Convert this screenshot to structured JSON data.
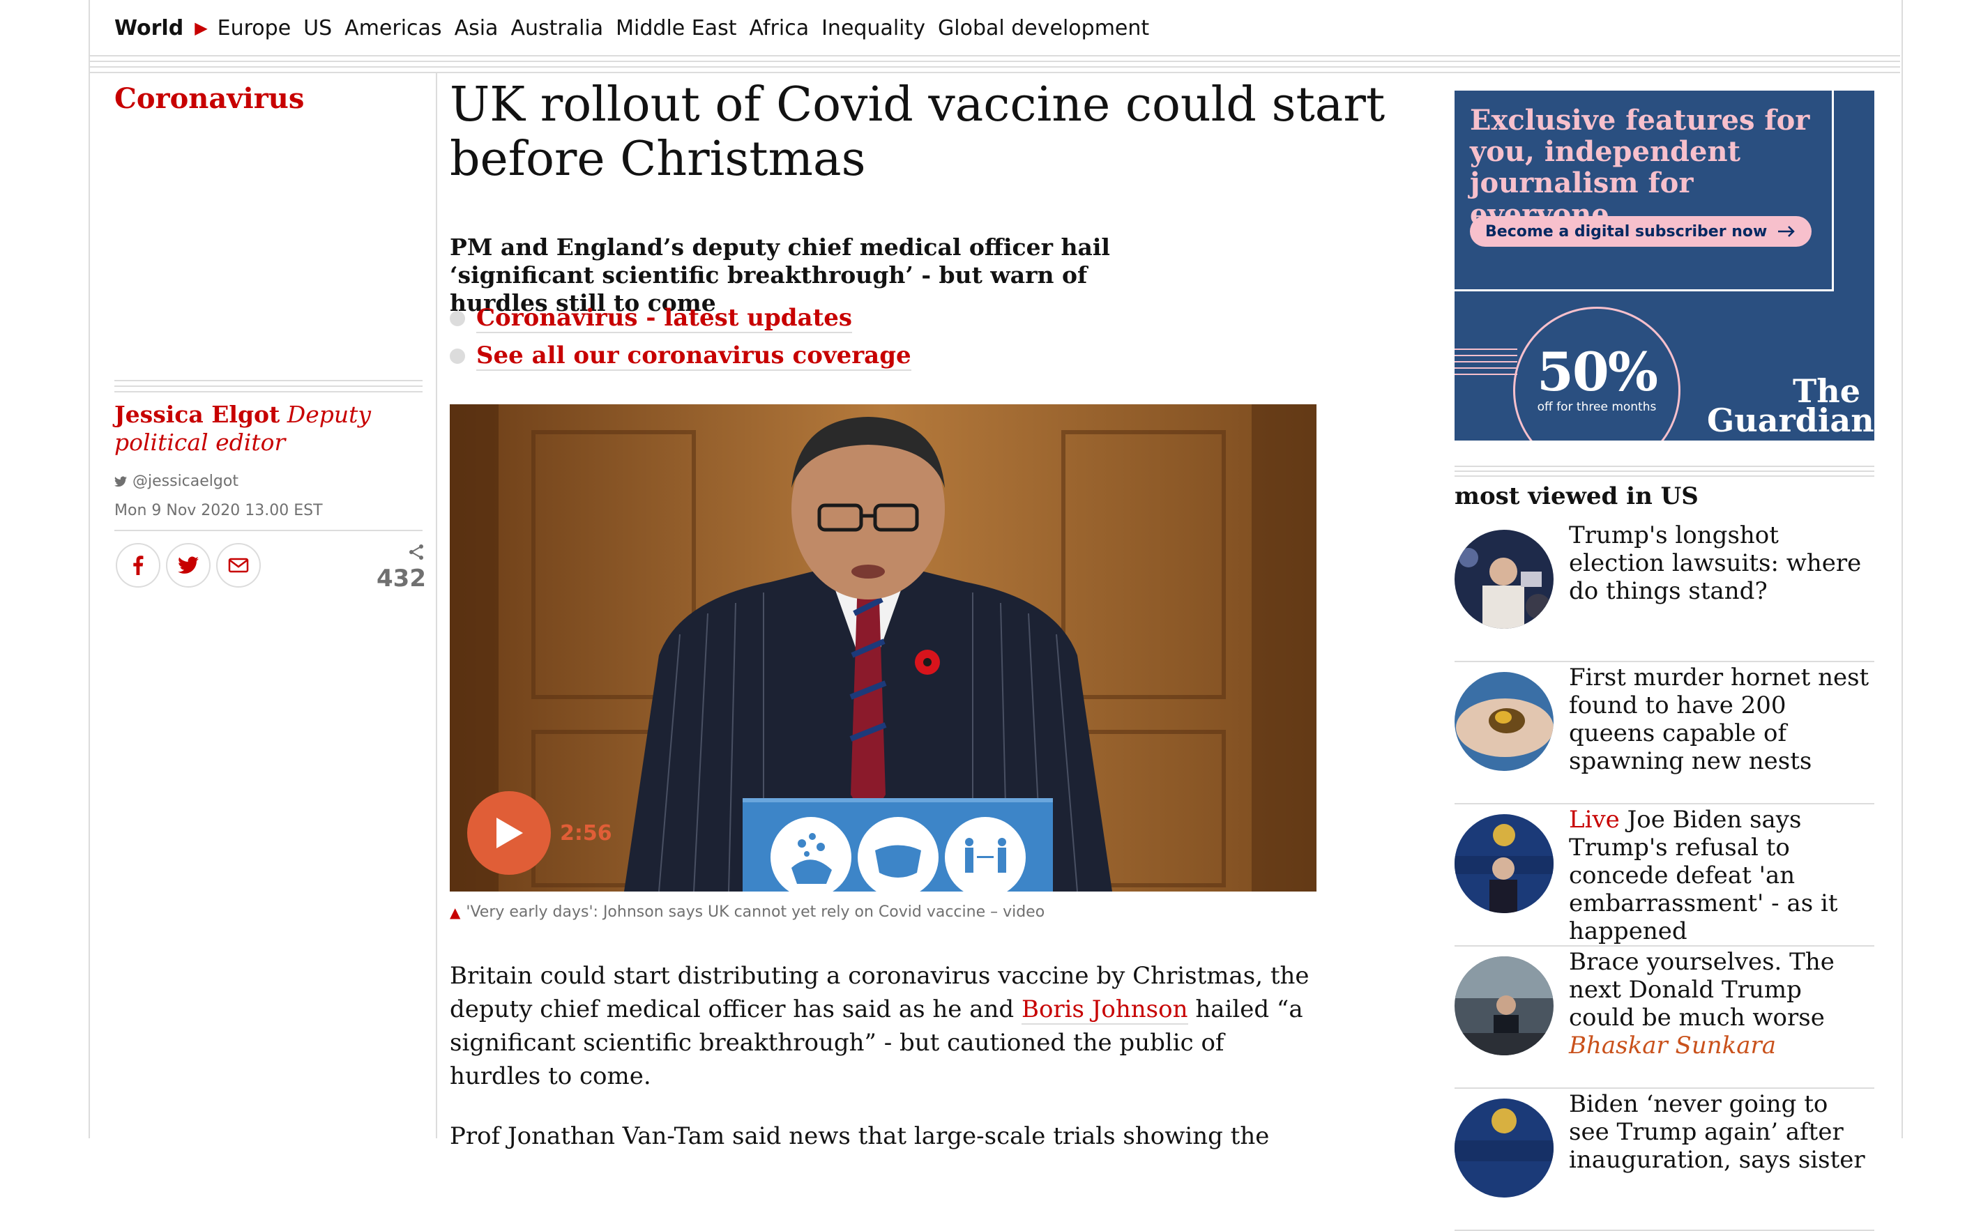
{
  "subnav": {
    "current": "World",
    "items": [
      "Europe",
      "US",
      "Americas",
      "Asia",
      "Australia",
      "Middle East",
      "Africa",
      "Inequality",
      "Global development"
    ]
  },
  "article": {
    "section": "Coronavirus",
    "headline": "UK rollout of Covid vaccine could start before Christmas",
    "standfirst": "PM and England’s deputy chief medical officer hail ‘significant scientific breakthrough’ - but warn of hurdles still to come",
    "related": [
      "Coronavirus - latest updates",
      "See all our coronavirus coverage"
    ],
    "author": "Jessica Elgot",
    "author_role": "Deputy political editor",
    "twitter": "@jessicaelgot",
    "date": "Mon 9 Nov 2020 13.00 EST",
    "share_count": "432",
    "video_duration": "2:56",
    "caption": "'Very early days': Johnson says UK cannot yet rely on Covid vaccine – video",
    "body": {
      "p1_a": "Britain could start distributing a coronavirus vaccine by Christmas, the deputy chief medical officer has said as he and ",
      "p1_link": "Boris Johnson",
      "p1_b": " hailed “a significant scientific breakthrough” - but cautioned the public of hurdles to come.",
      "p2": "Prof Jonathan Van-Tam said news that large-scale trials showing the"
    }
  },
  "ad": {
    "headline": "Exclusive features for you, independent journalism for everyone",
    "cta": "Become a digital subscriber now",
    "offer": "50%",
    "offer_sub": "off for three months",
    "logo_line1": "The",
    "logo_line2": "Guardian"
  },
  "most_viewed": {
    "title": "most viewed in US",
    "items": [
      {
        "kicker": "",
        "headline": "Trump's longshot election lawsuits: where do things stand?",
        "author": ""
      },
      {
        "kicker": "",
        "headline": "First murder hornet nest found to have 200 queens capable of spawning new nests",
        "author": ""
      },
      {
        "kicker": "Live",
        "headline": "Joe Biden says Trump's refusal to concede defeat 'an embarrassment' - as it happened",
        "author": ""
      },
      {
        "kicker": "",
        "headline": "Brace yourselves. The next Donald Trump could be much worse",
        "author": "Bhaskar Sunkara"
      },
      {
        "kicker": "",
        "headline": "Biden ‘never going to see Trump again’ after inauguration, says sister",
        "author": ""
      }
    ]
  },
  "colors": {
    "accent": "#c70000",
    "video_orange": "#e05e37",
    "ad_blue": "#2a4f80",
    "ad_pink": "#f7c0cc",
    "rule": "#dcdcdc"
  }
}
